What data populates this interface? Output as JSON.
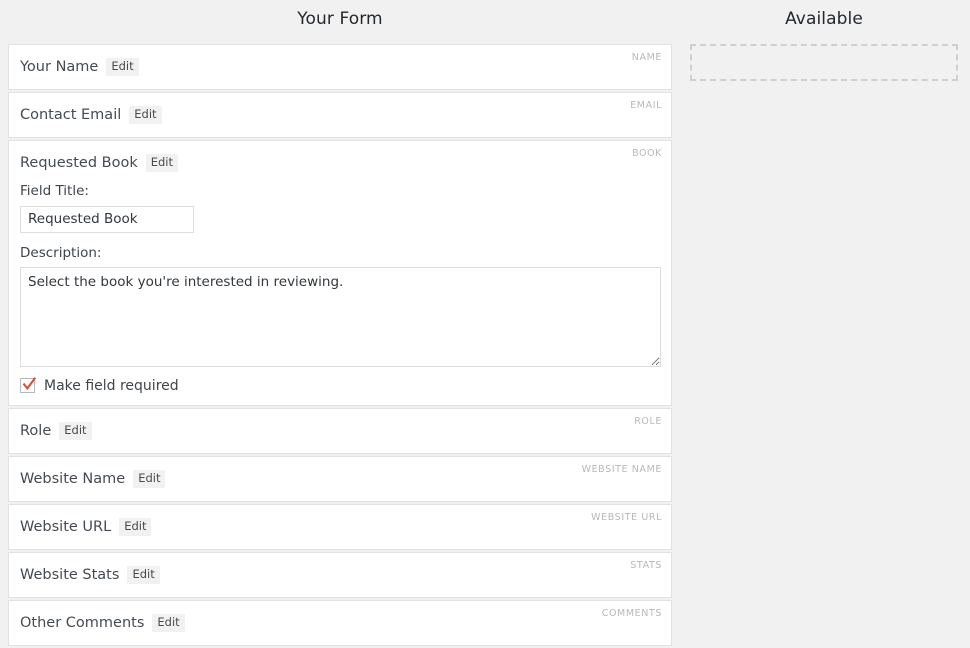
{
  "columns": {
    "form_heading": "Your Form",
    "available_heading": "Available"
  },
  "form_fields": [
    {
      "title": "Your Name",
      "edit_label": "Edit",
      "tag": "NAME",
      "expanded": false
    },
    {
      "title": "Contact Email",
      "edit_label": "Edit",
      "tag": "EMAIL",
      "expanded": false
    },
    {
      "title": "Requested Book",
      "edit_label": "Edit",
      "tag": "BOOK",
      "expanded": true
    },
    {
      "title": "Role",
      "edit_label": "Edit",
      "tag": "ROLE",
      "expanded": false
    },
    {
      "title": "Website Name",
      "edit_label": "Edit",
      "tag": "WEBSITE NAME",
      "expanded": false
    },
    {
      "title": "Website URL",
      "edit_label": "Edit",
      "tag": "WEBSITE URL",
      "expanded": false
    },
    {
      "title": "Website Stats",
      "edit_label": "Edit",
      "tag": "STATS",
      "expanded": false
    },
    {
      "title": "Other Comments",
      "edit_label": "Edit",
      "tag": "COMMENTS",
      "expanded": false
    }
  ],
  "editor": {
    "field_title_label": "Field Title:",
    "field_title_value": "Requested Book",
    "description_label": "Description:",
    "description_value": "Select the book you're interested in reviewing.",
    "required_label": "Make field required",
    "required_checked": true,
    "checkmark_color": "#d94f3d"
  },
  "available_panel": {
    "dropzone_text": ""
  }
}
